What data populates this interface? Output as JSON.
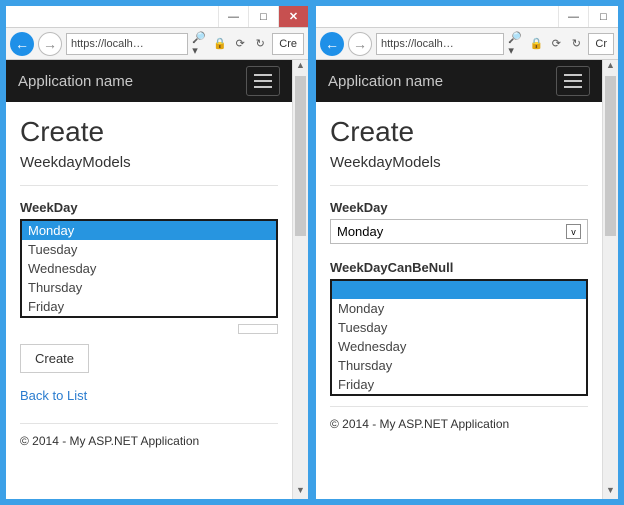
{
  "browser": {
    "url_text": "https://localh…",
    "tab_text_left": "Cre",
    "tab_text_right": "Cr"
  },
  "app_name": "Application name",
  "page_title": "Create",
  "subtitle": "WeekdayModels",
  "left": {
    "label_weekday": "WeekDay",
    "options": [
      "Monday",
      "Tuesday",
      "Wednesday",
      "Thursday",
      "Friday"
    ],
    "selected_index": 0,
    "create_btn": "Create",
    "back_link": "Back to List"
  },
  "right": {
    "label_weekday": "WeekDay",
    "dropdown_value": "Monday",
    "label_null": "WeekDayCanBeNull",
    "options": [
      "Monday",
      "Tuesday",
      "Wednesday",
      "Thursday",
      "Friday"
    ],
    "selected_blank": true
  },
  "footer_text": "© 2014 - My ASP.NET Application"
}
